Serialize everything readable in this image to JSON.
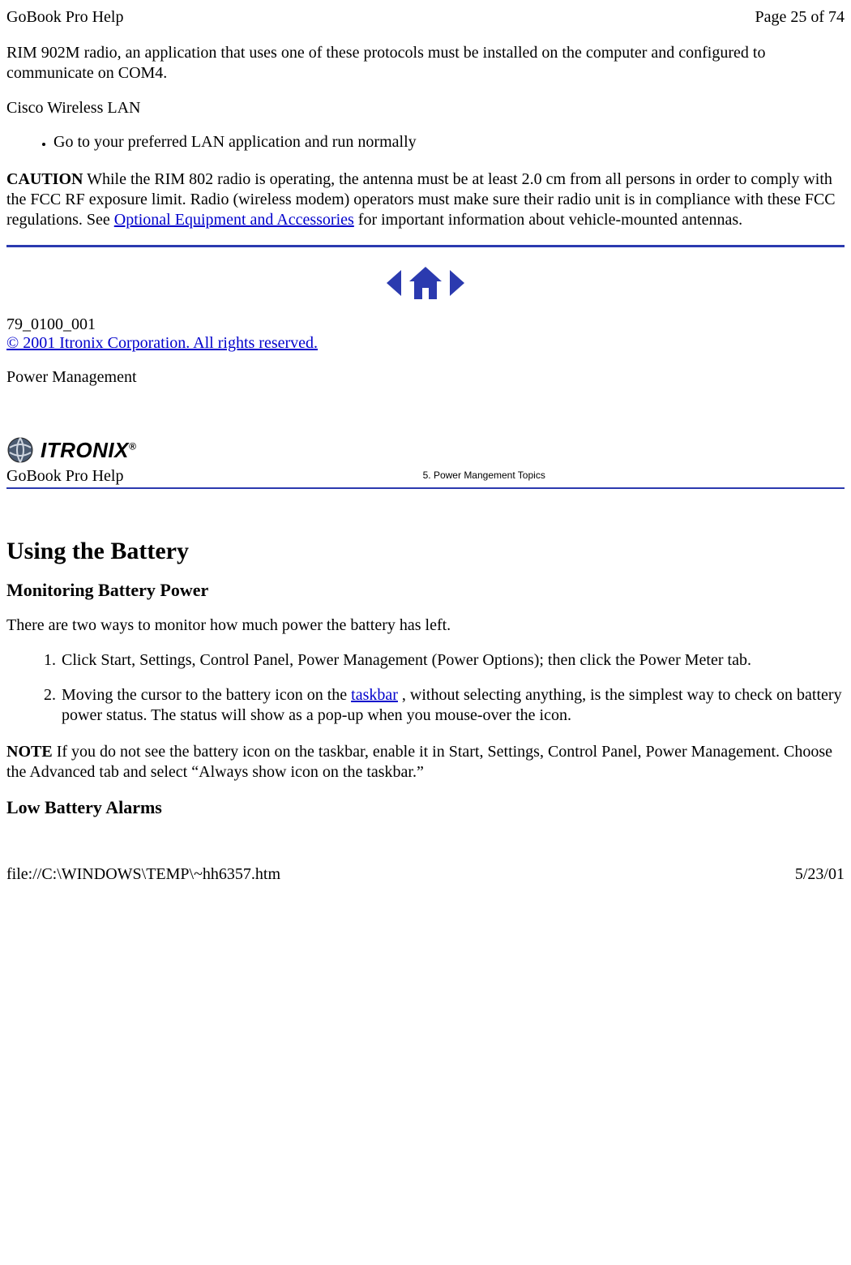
{
  "header": {
    "title": "GoBook Pro Help",
    "pagination": "Page 25 of 74"
  },
  "intro_paragraph": "RIM 902M radio, an application that uses one of these protocols must be installed on the computer and configured to communicate on COM4.",
  "subheading_cisco": "Cisco Wireless LAN",
  "lan_bullet": "Go to your preferred LAN application and run normally",
  "caution": {
    "label": "CAUTION",
    "text_before_link": "  While the RIM 802 radio is operating, the antenna must be at least 2.0 cm from all persons in order to comply with the FCC RF exposure limit.  Radio (wireless modem) operators must make sure their radio unit is in compliance with these FCC regulations.  See ",
    "link_text": "Optional Equipment and Accessories",
    "text_after_link": " for important information about vehicle-mounted antennas."
  },
  "doc_id": "79_0100_001",
  "copyright": "© 2001 Itronix Corporation.  All rights reserved.",
  "section_label": "Power Management",
  "logo_text": "ITRONIX",
  "help_box": {
    "left": "GoBook Pro Help",
    "right": "5. Power Mangement Topics"
  },
  "h2": "Using the Battery",
  "h3a": "Monitoring Battery Power",
  "monitor_intro": "There are two ways to monitor how much power the battery has left.",
  "steps": {
    "s1": "Click Start, Settings, Control Panel, Power Management (Power Options); then click the Power Meter tab.",
    "s2a": "Moving the cursor to the battery icon on the ",
    "s2_link": "taskbar",
    "s2b": " , without selecting anything,  is the simplest way to check on battery power status.  The status will show as a pop-up when you mouse-over the icon."
  },
  "note": {
    "label": "NOTE",
    "text": "  If you do not see the battery icon on the taskbar, enable it in Start, Settings, Control Panel, Power Management. Choose the Advanced tab and select “Always show icon on the taskbar.”"
  },
  "h3b": "Low Battery Alarms",
  "footer": {
    "path": "file://C:\\WINDOWS\\TEMP\\~hh6357.htm",
    "date": "5/23/01"
  }
}
